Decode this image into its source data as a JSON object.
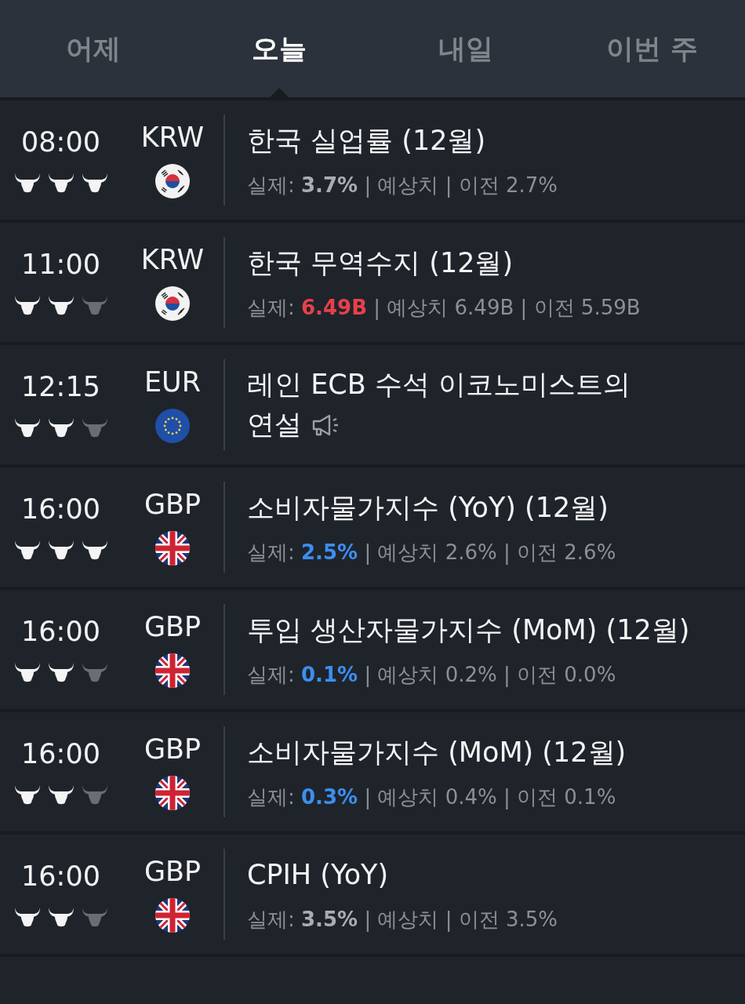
{
  "tabs": [
    {
      "label": "어제",
      "selected": false
    },
    {
      "label": "오늘",
      "selected": true
    },
    {
      "label": "내일",
      "selected": false
    },
    {
      "label": "이번 주",
      "selected": false
    }
  ],
  "events": [
    {
      "time": "08:00",
      "stars": 3,
      "currency": "KRW",
      "flag": {
        "kind": "korea"
      },
      "title": "한국 실업률 (12월)",
      "speech": false,
      "details": {
        "label": "실제:",
        "actual": "3.7%",
        "color": "#a9adb2",
        "rest": "| 예상치  | 이전 2.7%"
      }
    },
    {
      "time": "11:00",
      "stars": 2,
      "currency": "KRW",
      "flag": {
        "kind": "korea"
      },
      "title": "한국 무역수지 (12월)",
      "speech": false,
      "details": {
        "label": "실제:",
        "actual": "6.49B",
        "color": "#e8404b",
        "rest": "| 예상치 6.49B | 이전 5.59B"
      }
    },
    {
      "time": "12:15",
      "stars": 2,
      "currency": "EUR",
      "flag": {
        "kind": "eu"
      },
      "title": "레인 ECB 수석 이코노미스트의 연설",
      "speech": true
    },
    {
      "time": "16:00",
      "stars": 3,
      "currency": "GBP",
      "flag": {
        "kind": "uk"
      },
      "title": "소비자물가지수 (YoY) (12월)",
      "speech": false,
      "details": {
        "label": "실제:",
        "actual": "2.5%",
        "color": "#3d8ef0",
        "rest": "| 예상치 2.6% | 이전 2.6%"
      }
    },
    {
      "time": "16:00",
      "stars": 2,
      "currency": "GBP",
      "flag": {
        "kind": "uk"
      },
      "title": "투입 생산자물가지수 (MoM) (12월)",
      "speech": false,
      "details": {
        "label": "실제:",
        "actual": "0.1%",
        "color": "#3d8ef0",
        "rest": "| 예상치 0.2% | 이전 0.0%"
      }
    },
    {
      "time": "16:00",
      "stars": 2,
      "currency": "GBP",
      "flag": {
        "kind": "uk"
      },
      "title": "소비자물가지수 (MoM) (12월)",
      "speech": false,
      "details": {
        "label": "실제:",
        "actual": "0.3%",
        "color": "#3d8ef0",
        "rest": "| 예상치 0.4% | 이전 0.1%"
      }
    },
    {
      "time": "16:00",
      "stars": 2,
      "currency": "GBP",
      "flag": {
        "kind": "uk"
      },
      "title": "CPIH (YoY)",
      "speech": false,
      "details": {
        "label": "실제:",
        "actual": "3.5%",
        "color": "#a9adb2",
        "rest": "| 예상치  | 이전 3.5%"
      }
    }
  ]
}
